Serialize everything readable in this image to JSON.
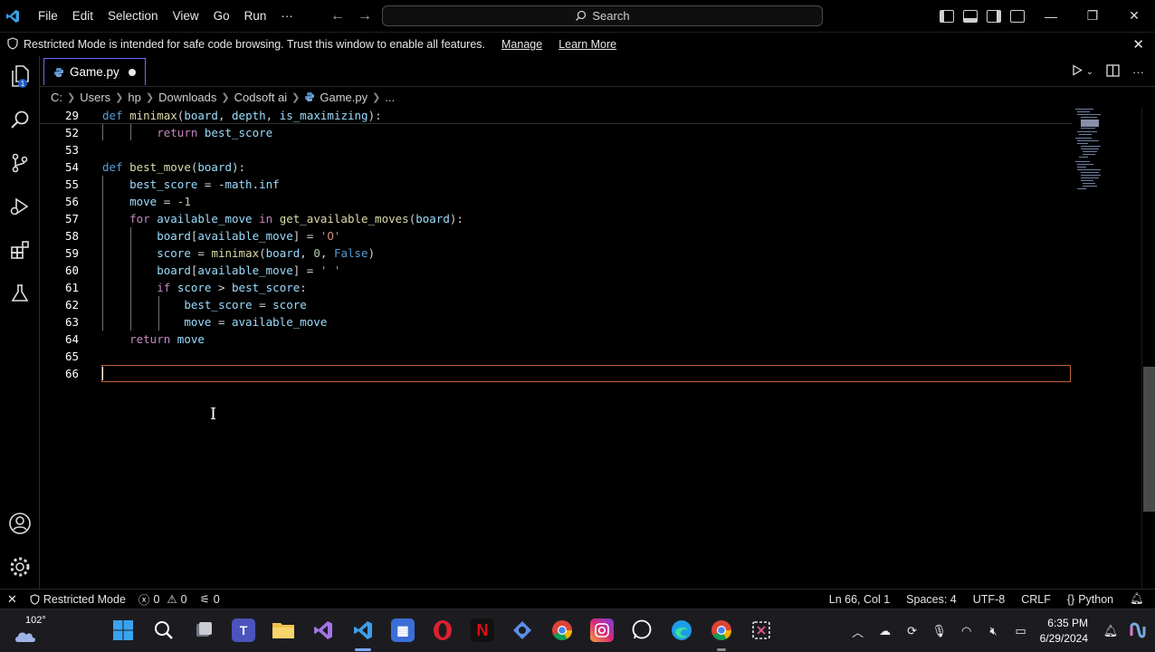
{
  "menubar": {
    "items": [
      "File",
      "Edit",
      "Selection",
      "View",
      "Go",
      "Run",
      "···"
    ],
    "search_placeholder": "Search"
  },
  "banner": {
    "message": "Restricted Mode is intended for safe code browsing. Trust this window to enable all features.",
    "manage_link": "Manage",
    "learn_more_link": "Learn More"
  },
  "tab": {
    "filename": "Game.py",
    "unsaved": true
  },
  "breadcrumb": [
    "C:",
    "Users",
    "hp",
    "Downloads",
    "Codsoft ai",
    "Game.py",
    "..."
  ],
  "editor": {
    "lines": [
      {
        "num": "29",
        "text": "def minimax(board, depth, is_maximizing):"
      },
      {
        "num": "52",
        "text": "return best_score"
      },
      {
        "num": "53",
        "text": ""
      },
      {
        "num": "54",
        "text": "def best_move(board):"
      },
      {
        "num": "55",
        "text": "best_score = -math.inf"
      },
      {
        "num": "56",
        "text": "move = -1"
      },
      {
        "num": "57",
        "text": "for available_move in get_available_moves(board):"
      },
      {
        "num": "58",
        "text": "board[available_move] = 'O'"
      },
      {
        "num": "59",
        "text": "score = minimax(board, 0, False)"
      },
      {
        "num": "60",
        "text": "board[available_move] = ' '"
      },
      {
        "num": "61",
        "text": "if score > best_score:"
      },
      {
        "num": "62",
        "text": "best_score = score"
      },
      {
        "num": "63",
        "text": "move = available_move"
      },
      {
        "num": "64",
        "text": "return move"
      },
      {
        "num": "65",
        "text": ""
      },
      {
        "num": "66",
        "text": ""
      }
    ]
  },
  "statusbar": {
    "mode": "Restricted Mode",
    "errors": "0",
    "warnings": "0",
    "ports": "0",
    "cursor": "Ln 66, Col 1",
    "spaces": "Spaces: 4",
    "encoding": "UTF-8",
    "eol": "CRLF",
    "language": "Python"
  },
  "taskbar": {
    "weather_temp": "102°",
    "time": "6:35 PM",
    "date": "6/29/2024"
  },
  "colors": {
    "accent": "#6b6bff",
    "keyword": "#569cd6",
    "control": "#c586c0",
    "function": "#dcdcaa",
    "variable": "#9cdcfe",
    "string": "#ce9178",
    "number": "#b5cea8",
    "current_line_border": "#c0623a"
  }
}
